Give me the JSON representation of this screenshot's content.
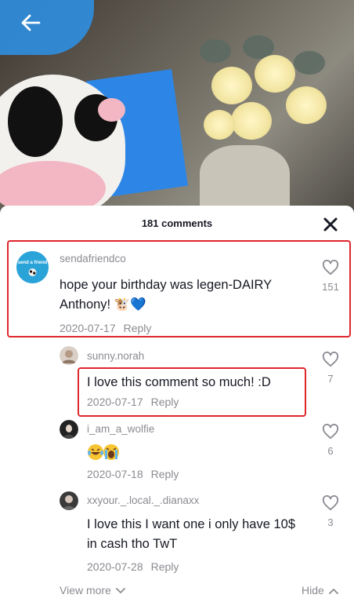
{
  "header": {
    "title": "181 comments"
  },
  "comments": [
    {
      "username": "sendafriendco",
      "avatar_text": "send a friend",
      "text": "hope your birthday was legen-DAIRY Anthony! 🐮💙",
      "date": "2020-07-17",
      "reply_label": "Reply",
      "likes": "151"
    }
  ],
  "replies": [
    {
      "username": "sunny.norah",
      "text": "I love this comment so much! :D",
      "date": "2020-07-17",
      "reply_label": "Reply",
      "likes": "7"
    },
    {
      "username": "i_am_a_wolfie",
      "text": "😂😭",
      "date": "2020-07-18",
      "reply_label": "Reply",
      "likes": "6"
    },
    {
      "username": "xxyour._.local._.dianaxx",
      "text": "I love this I want one i only have 10$ in cash tho TwT",
      "date": "2020-07-28",
      "reply_label": "Reply",
      "likes": "3"
    }
  ],
  "footer": {
    "view_more": "View more",
    "hide": "Hide"
  },
  "colors": {
    "highlight": "#e0262c",
    "muted": "#8a8b91",
    "text": "#161823",
    "avatar_bg": "#2aa3d9"
  },
  "icons": [
    "back-arrow-icon",
    "close-icon",
    "heart-outline-icon",
    "chevron-down-icon",
    "chevron-up-icon"
  ]
}
